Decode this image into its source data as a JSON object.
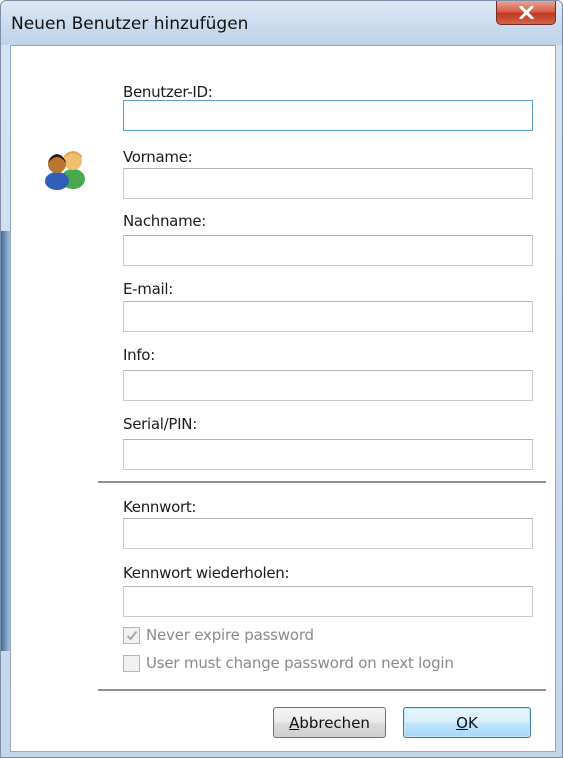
{
  "window": {
    "title": "Neuen Benutzer hinzufügen",
    "close_icon": "close-icon"
  },
  "form": {
    "icon": "users-icon",
    "fields": [
      {
        "label": "Benutzer-ID:",
        "value": "",
        "focused": true
      },
      {
        "label": "Vorname:",
        "value": ""
      },
      {
        "label": "Nachname:",
        "value": ""
      },
      {
        "label": "E-mail:",
        "value": ""
      },
      {
        "label": "Info:",
        "value": ""
      },
      {
        "label": "Serial/PIN:",
        "value": ""
      }
    ],
    "password_fields": [
      {
        "label": "Kennwort:",
        "value": ""
      },
      {
        "label": "Kennwort wiederholen:",
        "value": ""
      }
    ],
    "checkboxes": [
      {
        "label": "Never expire password",
        "checked": true,
        "disabled": true
      },
      {
        "label": "User must change password on next login",
        "checked": false,
        "disabled": true
      }
    ]
  },
  "buttons": {
    "cancel": "Abbrechen",
    "ok": "OK"
  }
}
